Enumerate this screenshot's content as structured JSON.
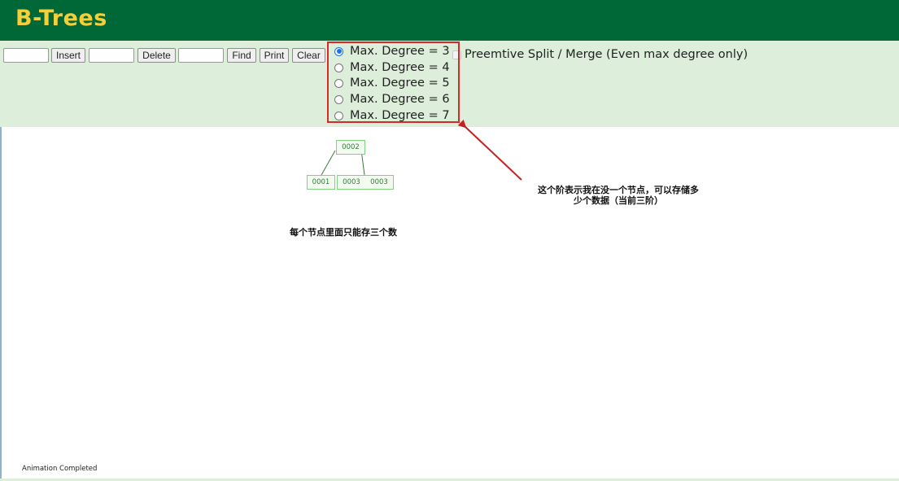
{
  "header": {
    "title": "B-Trees"
  },
  "colors": {
    "header_bg": "#006837",
    "title": "#f5cf3a",
    "controls_bg": "#ddeedb",
    "annotation": "#d42a2a",
    "node_border": "#7fd27f",
    "node_text": "#2e7d32"
  },
  "toolbar": {
    "insert_input": {
      "value": "",
      "placeholder": ""
    },
    "insert_label": "Insert",
    "delete_input": {
      "value": "",
      "placeholder": ""
    },
    "delete_label": "Delete",
    "find_input": {
      "value": "",
      "placeholder": ""
    },
    "find_label": "Find",
    "print_label": "Print",
    "clear_label": "Clear"
  },
  "degree_options": [
    {
      "label": "Max. Degree = 3",
      "checked": true
    },
    {
      "label": "Max. Degree = 4",
      "checked": false
    },
    {
      "label": "Max. Degree = 5",
      "checked": false
    },
    {
      "label": "Max. Degree = 6",
      "checked": false
    },
    {
      "label": "Max. Degree = 7",
      "checked": false
    }
  ],
  "preemptive": {
    "label": "Preemtive Split / Merge (Even max degree only)",
    "checked": false
  },
  "tree": {
    "root": {
      "keys": [
        "0002"
      ]
    },
    "children": [
      {
        "keys": [
          "0001"
        ]
      },
      {
        "keys": [
          "0003",
          "0003"
        ]
      }
    ]
  },
  "annotations": {
    "degree_note_line1": "这个阶表示我在没一个节点，可以存储多",
    "degree_note_line2": "少个数据（当前三阶）",
    "node_note": "每个节点里面只能存三个数"
  },
  "status": {
    "text": "Animation Completed"
  }
}
